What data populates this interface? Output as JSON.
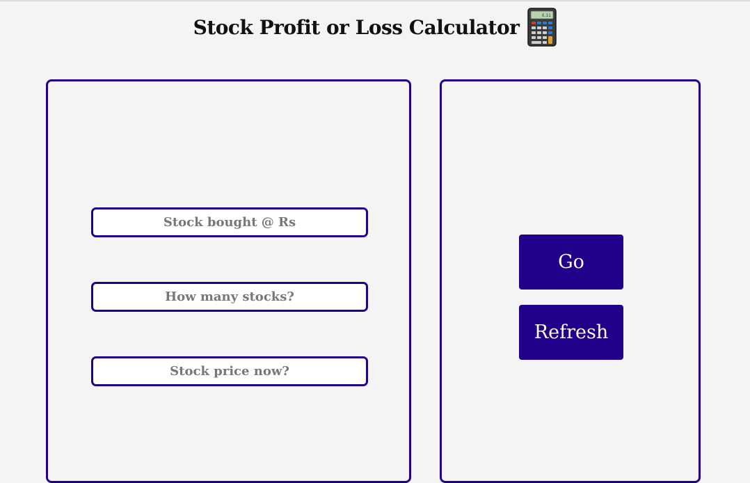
{
  "header": {
    "title": "Stock Profit or Loss Calculator",
    "icon": "calculator-icon"
  },
  "form": {
    "bought_placeholder": "Stock bought @ Rs",
    "quantity_placeholder": "How many stocks?",
    "current_placeholder": "Stock price now?"
  },
  "actions": {
    "go_label": "Go",
    "refresh_label": "Refresh"
  },
  "colors": {
    "accent": "#21008a",
    "background": "#f4f4f4",
    "placeholder": "#777777"
  }
}
